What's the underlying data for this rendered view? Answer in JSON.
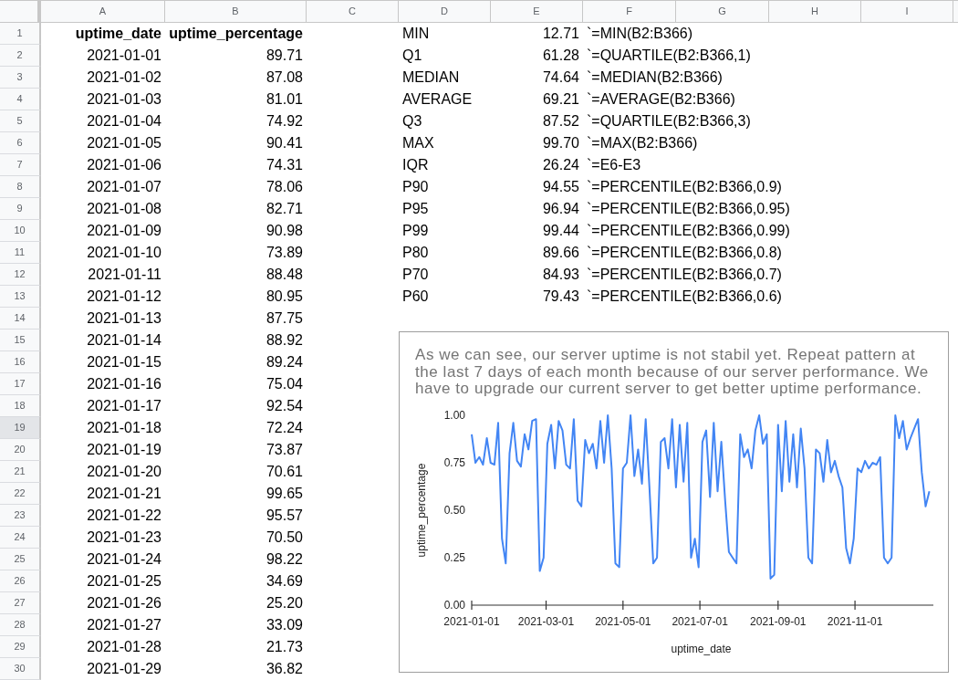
{
  "column_headers": [
    "A",
    "B",
    "C",
    "D",
    "E",
    "F",
    "G",
    "H",
    "I"
  ],
  "row_headers": [
    {
      "label": "1",
      "selected": false
    },
    {
      "label": "2",
      "selected": false
    },
    {
      "label": "3",
      "selected": false
    },
    {
      "label": "4",
      "selected": false
    },
    {
      "label": "5",
      "selected": false
    },
    {
      "label": "6",
      "selected": false
    },
    {
      "label": "7",
      "selected": false
    },
    {
      "label": "8",
      "selected": false
    },
    {
      "label": "9",
      "selected": false
    },
    {
      "label": "10",
      "selected": false
    },
    {
      "label": "11",
      "selected": false
    },
    {
      "label": "12",
      "selected": false
    },
    {
      "label": "13",
      "selected": false
    },
    {
      "label": "14",
      "selected": false
    },
    {
      "label": "15",
      "selected": false
    },
    {
      "label": "16",
      "selected": false
    },
    {
      "label": "17",
      "selected": false
    },
    {
      "label": "18",
      "selected": false
    },
    {
      "label": "19",
      "selected": true
    },
    {
      "label": "20",
      "selected": false
    },
    {
      "label": "21",
      "selected": false
    },
    {
      "label": "22",
      "selected": false
    },
    {
      "label": "23",
      "selected": false
    },
    {
      "label": "24",
      "selected": false
    },
    {
      "label": "25",
      "selected": false
    },
    {
      "label": "26",
      "selected": false
    },
    {
      "label": "27",
      "selected": false
    },
    {
      "label": "28",
      "selected": false
    },
    {
      "label": "29",
      "selected": false
    },
    {
      "label": "30",
      "selected": false
    }
  ],
  "uptime_table": {
    "columns": [
      "uptime_date",
      "uptime_percentage"
    ],
    "rows": [
      [
        "2021-01-01",
        "89.71"
      ],
      [
        "2021-01-02",
        "87.08"
      ],
      [
        "2021-01-03",
        "81.01"
      ],
      [
        "2021-01-04",
        "74.92"
      ],
      [
        "2021-01-05",
        "90.41"
      ],
      [
        "2021-01-06",
        "74.31"
      ],
      [
        "2021-01-07",
        "78.06"
      ],
      [
        "2021-01-08",
        "82.71"
      ],
      [
        "2021-01-09",
        "90.98"
      ],
      [
        "2021-01-10",
        "73.89"
      ],
      [
        "2021-01-11",
        "88.48"
      ],
      [
        "2021-01-12",
        "80.95"
      ],
      [
        "2021-01-13",
        "87.75"
      ],
      [
        "2021-01-14",
        "88.92"
      ],
      [
        "2021-01-15",
        "89.24"
      ],
      [
        "2021-01-16",
        "75.04"
      ],
      [
        "2021-01-17",
        "92.54"
      ],
      [
        "2021-01-18",
        "72.24"
      ],
      [
        "2021-01-19",
        "73.87"
      ],
      [
        "2021-01-20",
        "70.61"
      ],
      [
        "2021-01-21",
        "99.65"
      ],
      [
        "2021-01-22",
        "95.57"
      ],
      [
        "2021-01-23",
        "70.50"
      ],
      [
        "2021-01-24",
        "98.22"
      ],
      [
        "2021-01-25",
        "34.69"
      ],
      [
        "2021-01-26",
        "25.20"
      ],
      [
        "2021-01-27",
        "33.09"
      ],
      [
        "2021-01-28",
        "21.73"
      ],
      [
        "2021-01-29",
        "36.82"
      ]
    ]
  },
  "stats": [
    {
      "label": "MIN",
      "value": "12.71",
      "formula": "`=MIN(B2:B366)"
    },
    {
      "label": "Q1",
      "value": "61.28",
      "formula": "`=QUARTILE(B2:B366,1)"
    },
    {
      "label": "MEDIAN",
      "value": "74.64",
      "formula": "`=MEDIAN(B2:B366)"
    },
    {
      "label": "AVERAGE",
      "value": "69.21",
      "formula": "`=AVERAGE(B2:B366)"
    },
    {
      "label": "Q3",
      "value": "87.52",
      "formula": "`=QUARTILE(B2:B366,3)"
    },
    {
      "label": "MAX",
      "value": "99.70",
      "formula": "`=MAX(B2:B366)"
    },
    {
      "label": "IQR",
      "value": "26.24",
      "formula": "`=E6-E3"
    },
    {
      "label": "P90",
      "value": "94.55",
      "formula": "`=PERCENTILE(B2:B366,0.9)"
    },
    {
      "label": "P95",
      "value": "96.94",
      "formula": "`=PERCENTILE(B2:B366,0.95)"
    },
    {
      "label": "P99",
      "value": "99.44",
      "formula": "`=PERCENTILE(B2:B366,0.99)"
    },
    {
      "label": "P80",
      "value": "89.66",
      "formula": "`=PERCENTILE(B2:B366,0.8)"
    },
    {
      "label": "P70",
      "value": "84.93",
      "formula": "`=PERCENTILE(B2:B366,0.7)"
    },
    {
      "label": "P60",
      "value": "79.43",
      "formula": "`=PERCENTILE(B2:B366,0.6)"
    }
  ],
  "chart": {
    "chart_data": {
      "type": "line",
      "title": "As we can see, our server uptime is not stabil yet. Repeat pattern at the last 7 days of each month because of our server performance. We have to upgrade our current server to get better uptime performance.",
      "xlabel": "uptime_date",
      "ylabel": "uptime_percentage",
      "color": "#4285f4",
      "xlim": [
        "2021-01-01",
        "2021-12-31"
      ],
      "ylim": [
        0,
        1
      ],
      "xticks": [
        "2021-01-01",
        "2021-03-01",
        "2021-05-01",
        "2021-07-01",
        "2021-09-01",
        "2021-11-01"
      ],
      "yticks": [
        {
          "value": 0,
          "label": "0.00"
        },
        {
          "value": 0.25,
          "label": "0.25"
        },
        {
          "value": 0.5,
          "label": "0.50"
        },
        {
          "value": 0.75,
          "label": "0.75"
        },
        {
          "value": 1,
          "label": "1.00"
        }
      ],
      "x": [
        "2021-01-01",
        "2021-01-04",
        "2021-01-07",
        "2021-01-10",
        "2021-01-13",
        "2021-01-16",
        "2021-01-19",
        "2021-01-22",
        "2021-01-25",
        "2021-01-28",
        "2021-01-31",
        "2021-02-03",
        "2021-02-06",
        "2021-02-09",
        "2021-02-12",
        "2021-02-15",
        "2021-02-18",
        "2021-02-21",
        "2021-02-24",
        "2021-02-27",
        "2021-03-02",
        "2021-03-05",
        "2021-03-08",
        "2021-03-11",
        "2021-03-14",
        "2021-03-17",
        "2021-03-20",
        "2021-03-23",
        "2021-03-26",
        "2021-03-29",
        "2021-04-01",
        "2021-04-04",
        "2021-04-07",
        "2021-04-10",
        "2021-04-13",
        "2021-04-16",
        "2021-04-19",
        "2021-04-22",
        "2021-04-25",
        "2021-04-28",
        "2021-05-01",
        "2021-05-04",
        "2021-05-07",
        "2021-05-10",
        "2021-05-13",
        "2021-05-16",
        "2021-05-19",
        "2021-05-22",
        "2021-05-25",
        "2021-05-28",
        "2021-05-31",
        "2021-06-03",
        "2021-06-06",
        "2021-06-09",
        "2021-06-12",
        "2021-06-15",
        "2021-06-18",
        "2021-06-21",
        "2021-06-24",
        "2021-06-27",
        "2021-06-30",
        "2021-07-03",
        "2021-07-06",
        "2021-07-09",
        "2021-07-12",
        "2021-07-15",
        "2021-07-18",
        "2021-07-21",
        "2021-07-24",
        "2021-07-27",
        "2021-07-30",
        "2021-08-02",
        "2021-08-05",
        "2021-08-08",
        "2021-08-11",
        "2021-08-14",
        "2021-08-17",
        "2021-08-20",
        "2021-08-23",
        "2021-08-26",
        "2021-08-29",
        "2021-09-01",
        "2021-09-04",
        "2021-09-07",
        "2021-09-10",
        "2021-09-13",
        "2021-09-16",
        "2021-09-19",
        "2021-09-22",
        "2021-09-25",
        "2021-09-28",
        "2021-10-01",
        "2021-10-04",
        "2021-10-07",
        "2021-10-10",
        "2021-10-13",
        "2021-10-16",
        "2021-10-19",
        "2021-10-22",
        "2021-10-25",
        "2021-10-28",
        "2021-10-31",
        "2021-11-03",
        "2021-11-06",
        "2021-11-09",
        "2021-11-12",
        "2021-11-15",
        "2021-11-18",
        "2021-11-21",
        "2021-11-24",
        "2021-11-27",
        "2021-11-30",
        "2021-12-03",
        "2021-12-06",
        "2021-12-09",
        "2021-12-12",
        "2021-12-15",
        "2021-12-18",
        "2021-12-21",
        "2021-12-24",
        "2021-12-27",
        "2021-12-30"
      ],
      "values": [
        0.9,
        0.75,
        0.78,
        0.74,
        0.88,
        0.75,
        0.74,
        0.96,
        0.35,
        0.22,
        0.8,
        0.96,
        0.76,
        0.73,
        0.9,
        0.82,
        0.97,
        0.98,
        0.18,
        0.25,
        0.85,
        0.95,
        0.72,
        0.97,
        0.92,
        0.74,
        0.72,
        0.98,
        0.55,
        0.52,
        0.87,
        0.8,
        0.85,
        0.72,
        0.97,
        0.75,
        1.0,
        0.72,
        0.22,
        0.2,
        0.72,
        0.75,
        1.0,
        0.68,
        0.82,
        0.64,
        0.98,
        0.62,
        0.22,
        0.25,
        0.86,
        0.88,
        0.72,
        0.98,
        0.62,
        0.95,
        0.65,
        0.96,
        0.25,
        0.35,
        0.2,
        0.86,
        0.92,
        0.57,
        0.96,
        0.6,
        0.86,
        0.55,
        0.28,
        0.25,
        0.22,
        0.9,
        0.78,
        0.82,
        0.72,
        0.92,
        1.0,
        0.85,
        0.9,
        0.14,
        0.16,
        0.95,
        0.6,
        0.97,
        0.65,
        0.9,
        0.62,
        0.93,
        0.72,
        0.25,
        0.22,
        0.82,
        0.8,
        0.65,
        0.87,
        0.7,
        0.76,
        0.68,
        0.62,
        0.3,
        0.22,
        0.35,
        0.72,
        0.7,
        0.76,
        0.72,
        0.75,
        0.74,
        0.78,
        0.25,
        0.22,
        0.25,
        1.0,
        0.88,
        0.97,
        0.82,
        0.88,
        0.93,
        0.98,
        0.7,
        0.52,
        0.6
      ]
    }
  }
}
